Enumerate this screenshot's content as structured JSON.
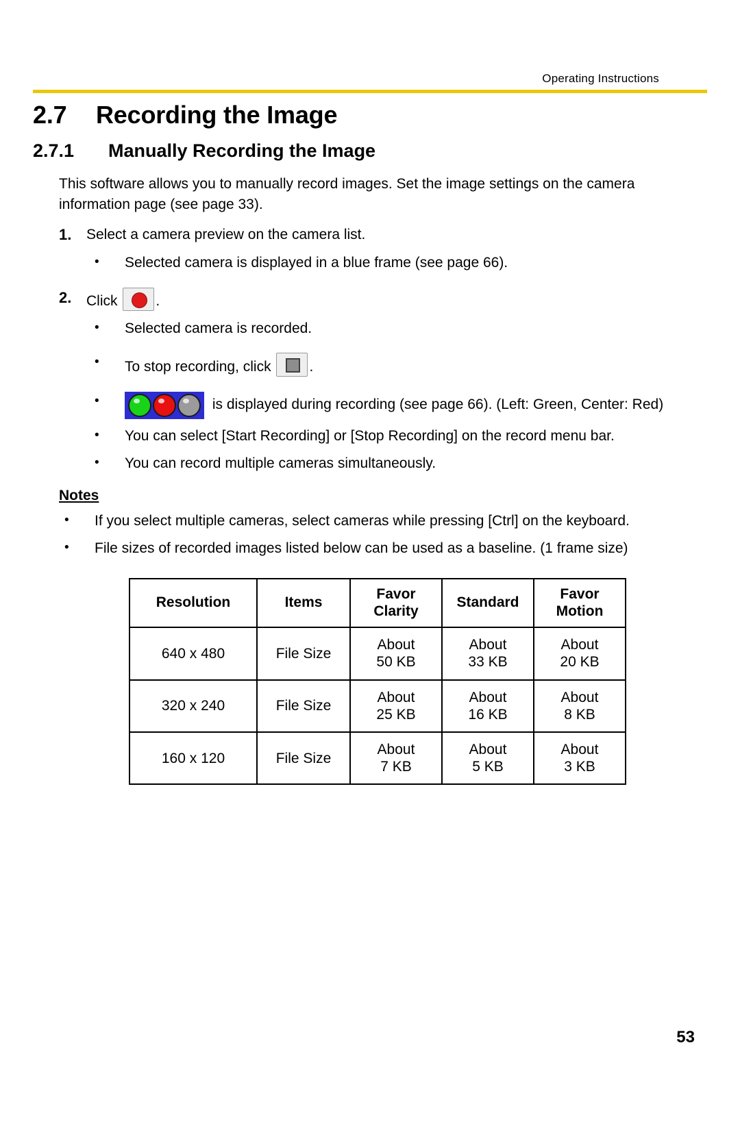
{
  "header": {
    "running_head": "Operating Instructions",
    "rule_color": "#e8c80a"
  },
  "section": {
    "number": "2.7",
    "title": "Recording the Image",
    "subsection_number": "2.7.1",
    "subsection_title": "Manually Recording the Image",
    "intro": "This software allows you to manually record images. Set the image settings on the camera information page (see page 33)."
  },
  "steps": [
    {
      "num": "1.",
      "text": "Select a camera preview on the camera list.",
      "bullets": [
        "Selected camera is displayed in a blue frame (see page 66)."
      ]
    },
    {
      "num": "2.",
      "text_before_icon": "Click",
      "text_after_icon": ".",
      "icon": "record-button-icon"
    }
  ],
  "step2_bullets": {
    "b1": "Selected camera is recorded.",
    "b2_before": "To stop recording, click",
    "b2_icon": "stop-button-icon",
    "b2_after": ".",
    "b3_text": "is displayed during recording (see page 66). (Left: Green, Center: Red)",
    "b3_icon": "recording-status-leds-icon",
    "b4": "You can select [Start Recording] or [Stop Recording] on the record menu bar.",
    "b5": "You can record multiple cameras simultaneously."
  },
  "notes": {
    "title": "Notes",
    "items": [
      "If you select multiple cameras, select cameras while pressing [Ctrl] on the keyboard.",
      "File sizes of recorded images listed below can be used as a baseline. (1 frame size)"
    ]
  },
  "table": {
    "headers": [
      "Resolution",
      "Items",
      "Favor Clarity",
      "Standard",
      "Favor Motion"
    ],
    "headers_split": [
      [
        "Resolution"
      ],
      [
        "Items"
      ],
      [
        "Favor",
        "Clarity"
      ],
      [
        "Standard"
      ],
      [
        "Favor",
        "Motion"
      ]
    ],
    "rows": [
      {
        "resolution": "640 x 480",
        "items": "File Size",
        "favor_clarity": [
          "About",
          "50 KB"
        ],
        "standard": [
          "About",
          "33 KB"
        ],
        "favor_motion": [
          "About",
          "20 KB"
        ]
      },
      {
        "resolution": "320 x 240",
        "items": "File Size",
        "favor_clarity": [
          "About",
          "25 KB"
        ],
        "standard": [
          "About",
          "16 KB"
        ],
        "favor_motion": [
          "About",
          "8 KB"
        ]
      },
      {
        "resolution": "160 x 120",
        "items": "File Size",
        "favor_clarity": [
          "About",
          "7 KB"
        ],
        "standard": [
          "About",
          "5 KB"
        ],
        "favor_motion": [
          "About",
          "3 KB"
        ]
      }
    ]
  },
  "footer": {
    "page_number": "53"
  },
  "bullet_glyph": "•",
  "colors": {
    "led_green": "#18d318",
    "led_red": "#e81010",
    "led_gray": "#9b9b9b",
    "led_frame_blue": "#2d2dd2",
    "record_red": "#e11b1b"
  }
}
